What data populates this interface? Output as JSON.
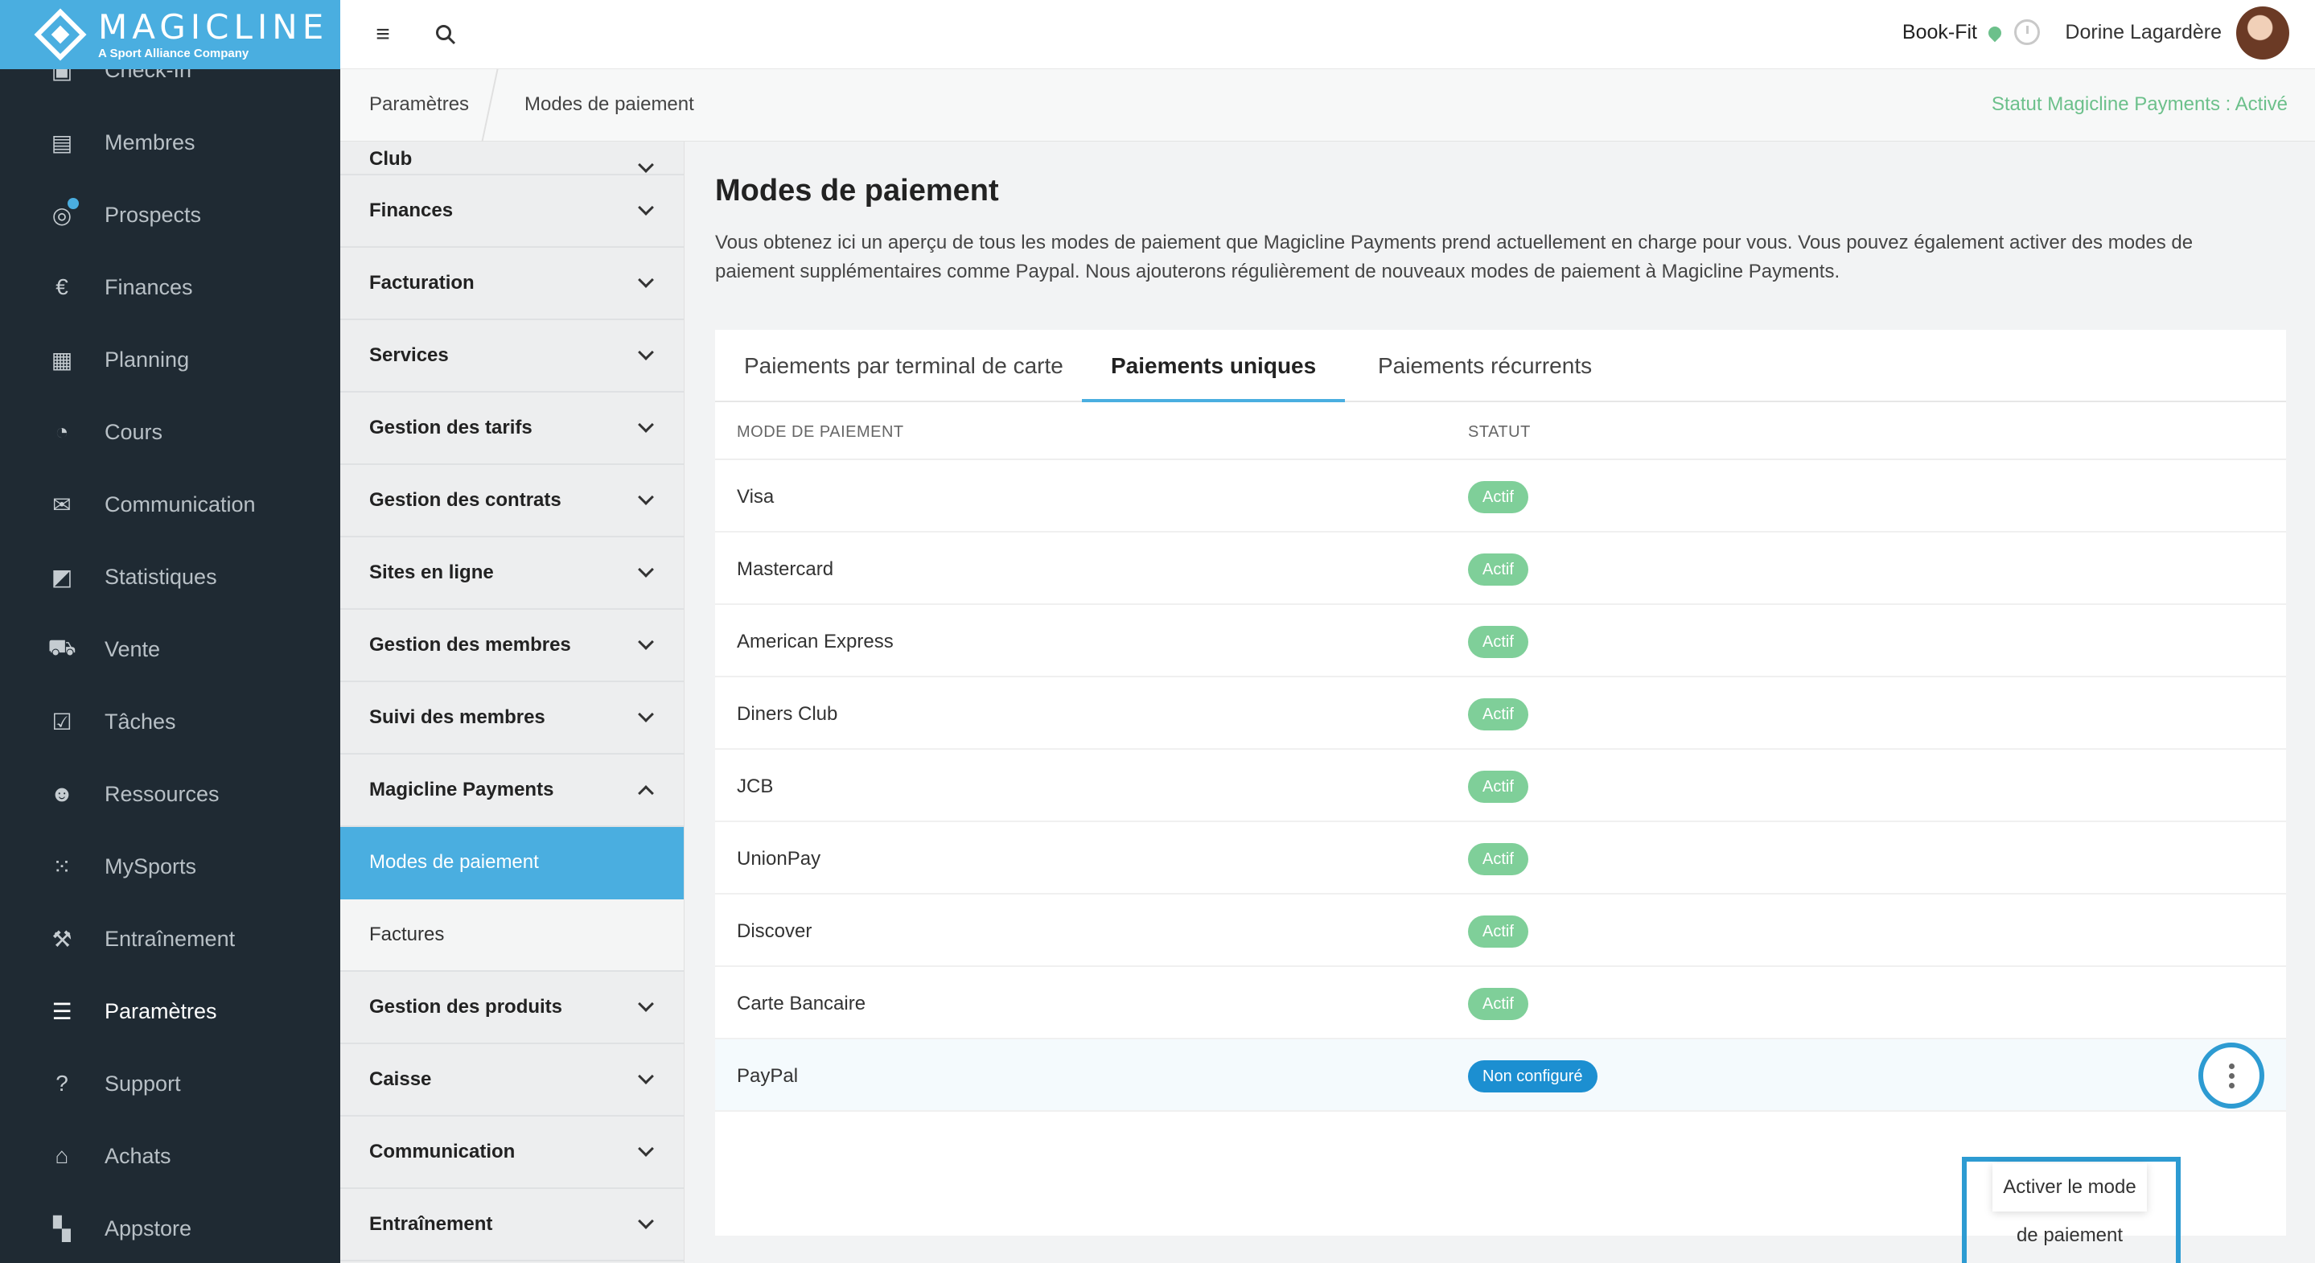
{
  "logo": {
    "title": "MAGICLINE",
    "subtitle": "A Sport Alliance Company"
  },
  "nav": {
    "items": [
      {
        "label": "Check-In",
        "icon": "checkin-icon"
      },
      {
        "label": "Membres",
        "icon": "members-icon"
      },
      {
        "label": "Prospects",
        "icon": "prospects-icon"
      },
      {
        "label": "Finances",
        "icon": "euro-icon"
      },
      {
        "label": "Planning",
        "icon": "calendar-icon"
      },
      {
        "label": "Cours",
        "icon": "stopwatch-icon"
      },
      {
        "label": "Communication",
        "icon": "chat-icon"
      },
      {
        "label": "Statistiques",
        "icon": "chart-icon"
      },
      {
        "label": "Vente",
        "icon": "cart-icon"
      },
      {
        "label": "Tâches",
        "icon": "checkbox-icon"
      },
      {
        "label": "Ressources",
        "icon": "people-icon"
      },
      {
        "label": "MySports",
        "icon": "dots-grid-icon"
      },
      {
        "label": "Entraînement",
        "icon": "dumbbell-icon"
      },
      {
        "label": "Paramètres",
        "icon": "sliders-icon",
        "active": true
      },
      {
        "label": "Support",
        "icon": "help-icon"
      },
      {
        "label": "Achats",
        "icon": "shop-icon"
      },
      {
        "label": "Appstore",
        "icon": "apps-icon"
      }
    ]
  },
  "topbar": {
    "studio": "Book-Fit",
    "user": "Dorine Lagardère"
  },
  "breadcrumb": {
    "parent": "Paramètres",
    "current": "Modes de paiement"
  },
  "payment_status": "Statut Magicline Payments : Activé",
  "submenu": {
    "partial": "Club",
    "items": [
      "Finances",
      "Facturation",
      "Services",
      "Gestion des tarifs",
      "Gestion des contrats",
      "Sites en ligne",
      "Gestion des membres",
      "Suivi des membres",
      "Magicline Payments"
    ],
    "children": [
      "Modes de paiement",
      "Factures"
    ],
    "items_after": [
      "Gestion des produits",
      "Caisse",
      "Communication",
      "Entraînement"
    ]
  },
  "page": {
    "title": "Modes de paiement",
    "description": "Vous obtenez ici un aperçu de tous les modes de paiement que Magicline Payments prend actuellement en charge pour vous. Vous pouvez également activer des modes de paiement supplémentaires comme Paypal. Nous ajouterons régulièrement de nouveaux modes de paiement à Magicline Payments."
  },
  "tabs": [
    "Paiements par terminal de carte",
    "Paiements uniques",
    "Paiements récurrents"
  ],
  "table": {
    "headers": {
      "method": "MODE DE PAIEMENT",
      "status": "STATUT"
    },
    "rows": [
      {
        "name": "Visa",
        "status": "Actif"
      },
      {
        "name": "Mastercard",
        "status": "Actif"
      },
      {
        "name": "American Express",
        "status": "Actif"
      },
      {
        "name": "Diners Club",
        "status": "Actif"
      },
      {
        "name": "JCB",
        "status": "Actif"
      },
      {
        "name": "UnionPay",
        "status": "Actif"
      },
      {
        "name": "Discover",
        "status": "Actif"
      },
      {
        "name": "Carte Bancaire",
        "status": "Actif"
      },
      {
        "name": "PayPal",
        "status": "Non configuré"
      }
    ]
  },
  "dropdown": {
    "activate": "Activer le mode de paiement"
  },
  "colors": {
    "brand": "#4aaee0",
    "sidebar": "#1f2a33",
    "active_badge": "#7fcf99",
    "unconfigured_badge": "#1c8fd1",
    "status_text": "#6cc08b"
  }
}
